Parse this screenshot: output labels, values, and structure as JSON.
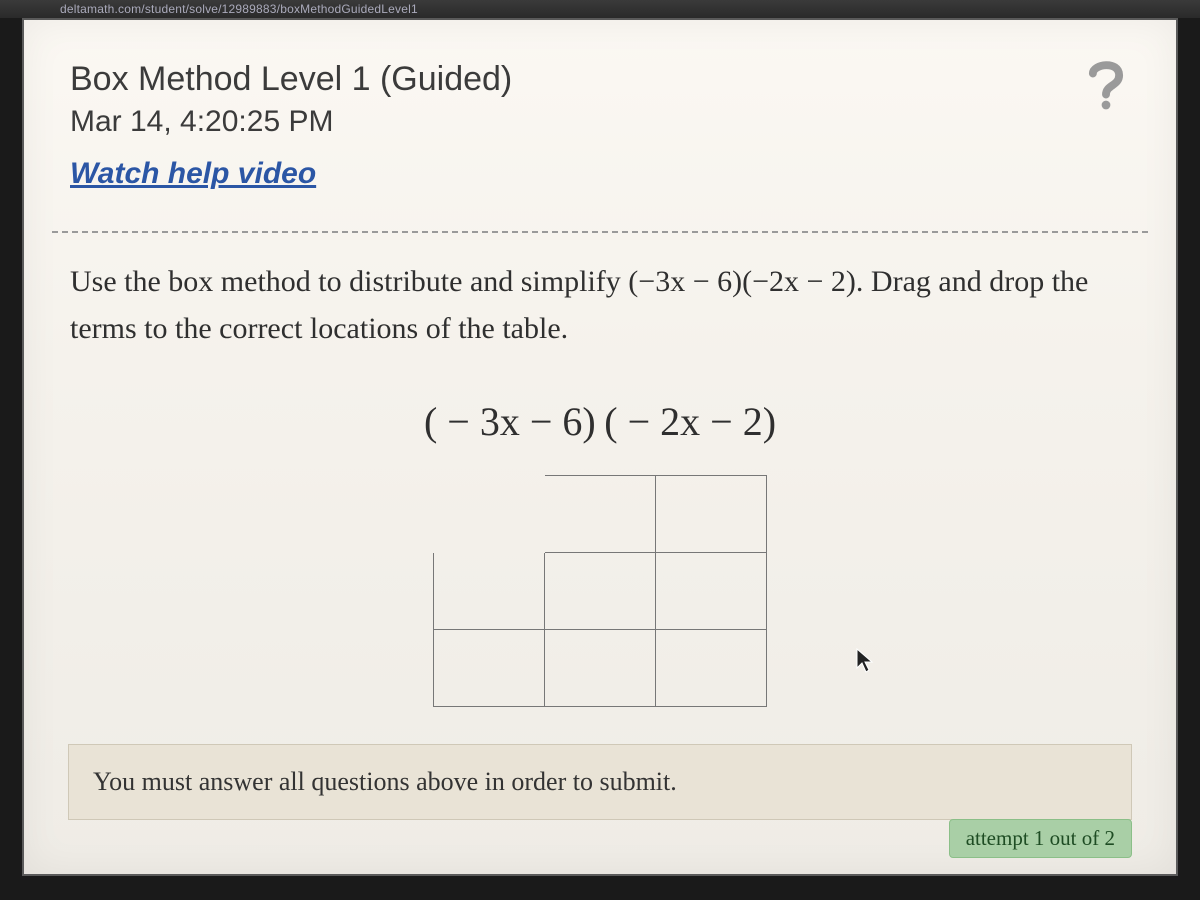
{
  "browser": {
    "url_fragment": "deltamath.com/student/solve/12989883/boxMethodGuidedLevel1"
  },
  "header": {
    "title": "Box Method Level 1 (Guided)",
    "timestamp": "Mar 14, 4:20:25 PM",
    "watch_help": "Watch help video"
  },
  "problem": {
    "instructions_prefix": "Use the box method to distribute and simplify ",
    "inline_expression": "(−3x − 6)(−2x − 2)",
    "instructions_suffix": ". Drag and drop the terms to the correct locations of the table.",
    "display_expression_part1": "( − 3x − 6)",
    "display_expression_part2": "( − 2x − 2)"
  },
  "table": {
    "rows": 3,
    "cols": 3
  },
  "footer": {
    "message": "You must answer all questions above in order to submit.",
    "attempt": "attempt 1 out of 2"
  },
  "icons": {
    "help": "question-mark-icon"
  }
}
